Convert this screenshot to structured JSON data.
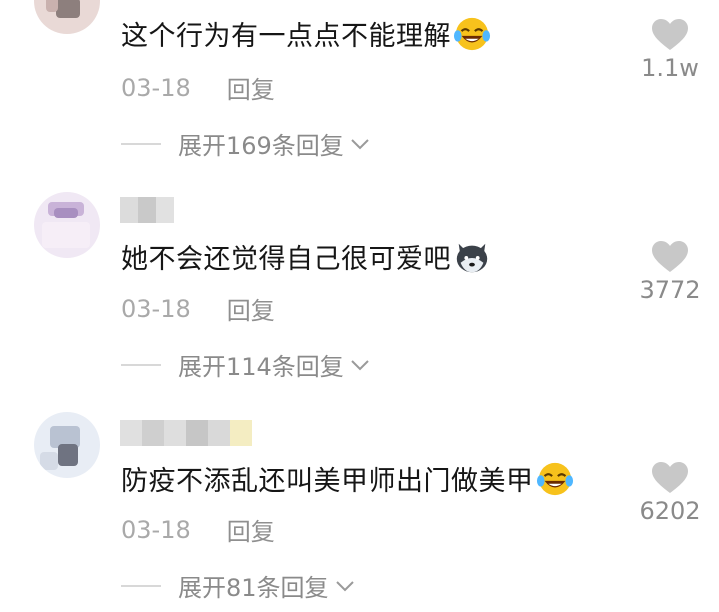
{
  "comments": [
    {
      "text": "这个行为有一点点不能理解",
      "emoji": "laughing-crying-emoji",
      "date": "03-18",
      "reply_label": "回复",
      "expand_label": "展开169条回复",
      "likes": "1.1w"
    },
    {
      "text": "她不会还觉得自己很可爱吧",
      "emoji": "husky-dog-emoji",
      "date": "03-18",
      "reply_label": "回复",
      "expand_label": "展开114条回复",
      "likes": "3772"
    },
    {
      "text": "防疫不添乱还叫美甲师出门做美甲",
      "emoji": "laughing-crying-emoji",
      "date": "03-18",
      "reply_label": "回复",
      "expand_label": "展开81条回复",
      "likes": "6202"
    }
  ],
  "icons": {
    "heart": "heart-icon",
    "expand": "chevron-down-icon"
  },
  "colors": {
    "text": "#161616",
    "meta": "#a9a9a9",
    "heart": "#c8c8c8"
  }
}
